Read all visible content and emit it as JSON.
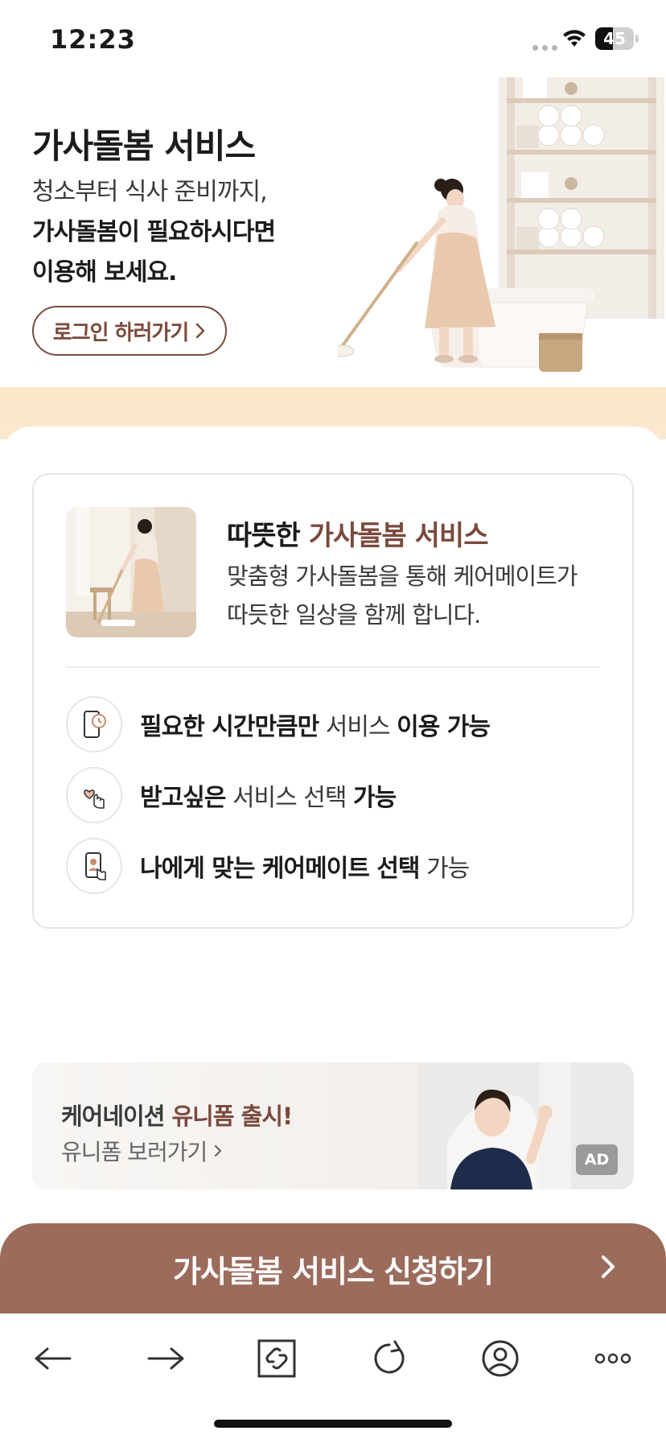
{
  "status_bar": {
    "time": "12:23",
    "battery": "45",
    "battery_level": 0.45
  },
  "hero": {
    "title": "가사돌봄 서비스",
    "line1": "청소부터 식사 준비까지,",
    "line2": "가사돌봄이 필요하시다면",
    "line3": "이용해 보세요.",
    "login_button": "로그인 하러가기"
  },
  "card": {
    "title_plain": "따뜻한 ",
    "title_accent": "가사돌봄 서비스",
    "desc_line1": "맞춤형 가사돌봄을 통해 케어메이트가",
    "desc_line2": "따듯한 일상을 함께 합니다.",
    "features": [
      {
        "icon": "phone-clock-icon",
        "b1": "필요한 시간만큼만",
        "t1": " 서비스 ",
        "b2": "이용 가능",
        "t2": ""
      },
      {
        "icon": "heart-hand-icon",
        "b1": "받고싶은",
        "t1": " 서비스 선택 ",
        "b2": "가능",
        "t2": ""
      },
      {
        "icon": "person-card-icon",
        "b1": "나에게 맞는 케어메이트 선택",
        "t1": " 가능",
        "b2": "",
        "t2": ""
      }
    ]
  },
  "ad": {
    "title_plain": "케어네이션 ",
    "title_accent": "유니폼 출시!",
    "link": "유니폼 보러가기",
    "badge": "AD"
  },
  "cta": {
    "label": "가사돌봄 서비스 신청하기"
  },
  "toolbar": {
    "items": [
      "back-arrow-icon",
      "forward-arrow-icon",
      "link-icon",
      "refresh-icon",
      "profile-icon",
      "more-icon"
    ]
  },
  "colors": {
    "accent": "#7a4a3c",
    "cta": "#9b6b5c",
    "floor": "#fbe6c9"
  }
}
